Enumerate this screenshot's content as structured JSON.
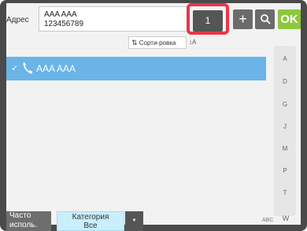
{
  "header": {
    "address_label": "Адрес",
    "address_name": "AAA AAA",
    "address_number": "123456789",
    "count_value": "1",
    "plus_icon": "plus-icon",
    "search_icon": "search-icon",
    "ok_label": "OK"
  },
  "sort": {
    "label": "Сорти-ровка",
    "az_label": "A"
  },
  "list": {
    "items": [
      {
        "name": "AAA AAA",
        "selected": true,
        "type_icon": "phone-icon"
      }
    ]
  },
  "index": [
    "A",
    "D",
    "G",
    "J",
    "M",
    "P",
    "T"
  ],
  "footer": {
    "frequent_label_1": "Часто",
    "frequent_label_2": "исполь.",
    "category_label": "Категория",
    "category_value": "Все",
    "abc_label": "ABC",
    "w_label": "W"
  },
  "colors": {
    "highlight": "#e8364a",
    "selected_row": "#6ab4e8",
    "ok": "#8ec63f"
  }
}
